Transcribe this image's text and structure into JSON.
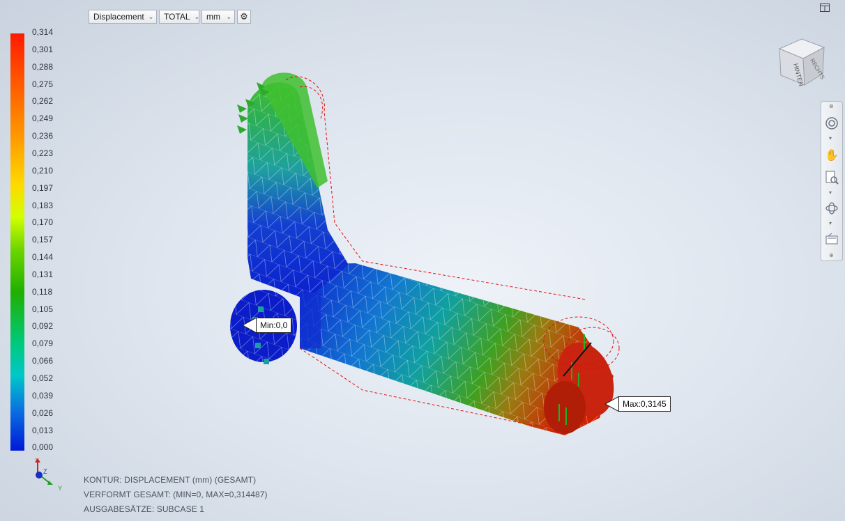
{
  "toolbar": {
    "result_type": "Displacement",
    "component": "TOTAL",
    "unit": "mm"
  },
  "legend": {
    "ticks": [
      "0,314",
      "0,301",
      "0,288",
      "0,275",
      "0,262",
      "0,249",
      "0,236",
      "0,223",
      "0,210",
      "0,197",
      "0,183",
      "0,170",
      "0,157",
      "0,144",
      "0,131",
      "0,118",
      "0,105",
      "0,092",
      "0,079",
      "0,066",
      "0,052",
      "0,039",
      "0,026",
      "0,013",
      "0,000"
    ]
  },
  "callouts": {
    "min": "Min:0,0",
    "max": "Max:0,3145"
  },
  "viewcube": {
    "face_top": "RECHTS",
    "face_side": "HINTEN"
  },
  "axis_triad": {
    "x": "X",
    "y": "Y",
    "z": "Z"
  },
  "status": {
    "line1": "KONTUR: DISPLACEMENT (mm) (GESAMT)",
    "line2": "VERFORMT GESAMT: (MIN=0, MAX=0,314487)",
    "line3": "AUSGABESÄTZE: SUBCASE 1"
  },
  "colors": {
    "max": "#ff1a00",
    "mid": "#1fb000",
    "min": "#0018d8"
  }
}
